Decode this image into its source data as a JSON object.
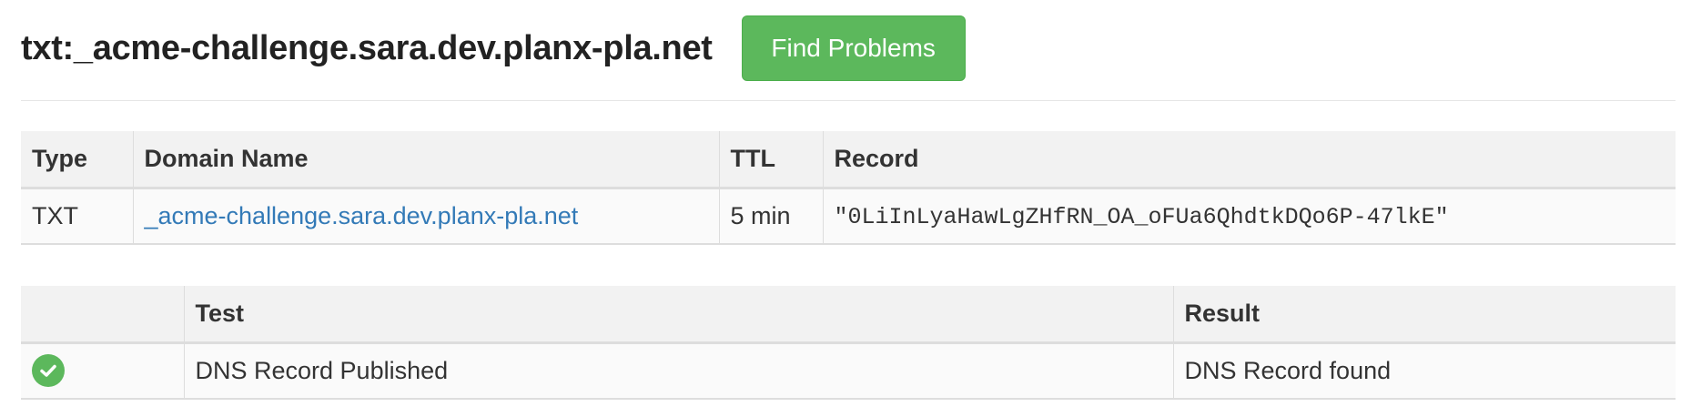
{
  "header": {
    "title": "txt:_acme-challenge.sara.dev.planx-pla.net",
    "find_button_label": "Find Problems"
  },
  "records_table": {
    "columns": [
      "Type",
      "Domain Name",
      "TTL",
      "Record"
    ],
    "rows": [
      {
        "type": "TXT",
        "domain": "_acme-challenge.sara.dev.planx-pla.net",
        "ttl": "5 min",
        "record": "\"0LiInLyaHawLgZHfRN_OA_oFUa6QhdtkDQo6P-47lkE\""
      }
    ]
  },
  "tests_table": {
    "columns": [
      "",
      "Test",
      "Result"
    ],
    "rows": [
      {
        "status_icon": "check-circle-icon",
        "test": "DNS Record Published",
        "result": "DNS Record found"
      }
    ]
  },
  "colors": {
    "success": "#5cb85c",
    "link": "#337ab7",
    "header_bg": "#f2f2f2"
  }
}
